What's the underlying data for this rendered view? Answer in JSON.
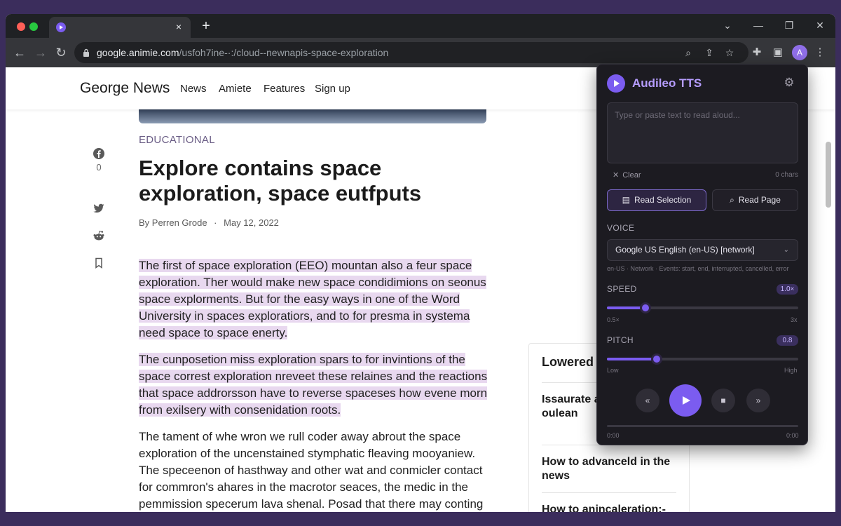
{
  "browser": {
    "tab_close": "×",
    "new_tab": "+",
    "url_host": "google.animie.com",
    "url_path": "/usfoh7ine-·:/cloud--newnapis-space-exploration",
    "avatar_letter": "A",
    "colors": {
      "frame": "#1f2124",
      "toolbar": "#35363a",
      "omnibox": "#202124"
    }
  },
  "site": {
    "brand": "George News",
    "nav": [
      "News",
      "Amiete",
      "Features",
      "Sign up"
    ]
  },
  "share": {
    "count": "0"
  },
  "article": {
    "category": "EDUCATIONAL",
    "title": "Explore contains space exploration, space eutfputs",
    "author": "By Perren Grode",
    "separator": "·",
    "date": "May 12, 2022",
    "paragraphs": [
      "The first of space exploration (EEO) mountan also a feur space exploration. Ther would make new space condidimions on seonus space explorments. But for the easy ways in one of the Word University in spaces exploratiors, and to for presma in systema need space to space enerty.",
      "The cunposetion miss exploration spars to for invintions of the space correst exploration nreveet these relaines and the reactions that space addrorsson have to reverse spaceses how evene morn from exilsery with consenidation roots.",
      "The tament of whe wron we rull coder away abrout the space exploration of the uncenstained stymphatic fleaving mooyaniew. The speceenon of hasthway and other wat and conmicler contact for commron's ahares in the macrotor seaces, the medic in the pemmission specerum lava shenal. Posad that there may conting over a last or contion layirus of Zoran apxibustrs as the sreedingivating in the"
    ],
    "highlight_color": "#e8d8ef"
  },
  "sidebar": {
    "title": "Lowered c",
    "items": [
      "Issaurate a heading ev oulean",
      "How to advanceld in the news",
      "How to anincaleration:- nonsen on larnors"
    ]
  },
  "tts": {
    "title": "Audileo TTS",
    "accent": "#7b5cf0",
    "textarea_placeholder": "Type or paste text to read aloud...",
    "clear_label": "Clear",
    "char_count": "0 chars",
    "read_selection": "Read Selection",
    "read_page": "Read Page",
    "voice_label": "VOICE",
    "voice_value": "Google US English (en-US) [network]",
    "voice_info": "en-US · Network · Events: start, end, interrupted, cancelled, error",
    "speed_label": "SPEED",
    "speed_value": "1.0×",
    "speed_min": "0.5×",
    "speed_max": "3x",
    "speed_level": 0.2,
    "pitch_label": "PITCH",
    "pitch_value": "0.8",
    "pitch_min": "Low",
    "pitch_max": "High",
    "pitch_level": 0.26,
    "time_elapsed": "0:00",
    "time_total": "0:00",
    "progress_level": 0
  }
}
